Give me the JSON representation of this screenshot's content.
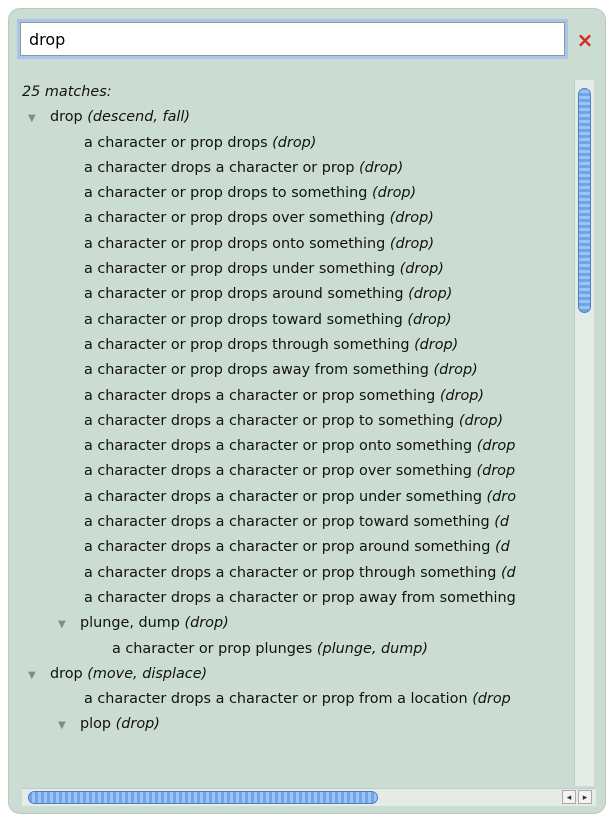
{
  "search": {
    "value": "drop",
    "clear_icon": "×"
  },
  "results": {
    "count_label": "25 matches:",
    "rows": [
      {
        "level": 0,
        "tri": true,
        "text": "drop ",
        "italic": "(descend, fall)"
      },
      {
        "level": 2,
        "tri": false,
        "text": "a character or prop drops ",
        "italic": "(drop)"
      },
      {
        "level": 2,
        "tri": false,
        "text": "a character drops a character or prop ",
        "italic": "(drop)"
      },
      {
        "level": 2,
        "tri": false,
        "text": "a character or prop drops to something ",
        "italic": "(drop)"
      },
      {
        "level": 2,
        "tri": false,
        "text": "a character or prop drops over something ",
        "italic": "(drop)"
      },
      {
        "level": 2,
        "tri": false,
        "text": "a character or prop drops onto something ",
        "italic": "(drop)"
      },
      {
        "level": 2,
        "tri": false,
        "text": "a character or prop drops under something ",
        "italic": "(drop)"
      },
      {
        "level": 2,
        "tri": false,
        "text": "a character or prop drops around something ",
        "italic": "(drop)"
      },
      {
        "level": 2,
        "tri": false,
        "text": "a character or prop drops toward something ",
        "italic": "(drop)"
      },
      {
        "level": 2,
        "tri": false,
        "text": "a character or prop drops through something ",
        "italic": "(drop)"
      },
      {
        "level": 2,
        "tri": false,
        "text": "a character or prop drops away from something ",
        "italic": "(drop)"
      },
      {
        "level": 2,
        "tri": false,
        "text": "a character drops a character or prop something ",
        "italic": "(drop)"
      },
      {
        "level": 2,
        "tri": false,
        "text": "a character drops a character or prop to something ",
        "italic": "(drop)"
      },
      {
        "level": 2,
        "tri": false,
        "text": "a character drops a character or prop onto something ",
        "italic": "(drop"
      },
      {
        "level": 2,
        "tri": false,
        "text": "a character drops a character or prop over something ",
        "italic": "(drop"
      },
      {
        "level": 2,
        "tri": false,
        "text": "a character drops a character or prop under something ",
        "italic": "(dro"
      },
      {
        "level": 2,
        "tri": false,
        "text": "a character drops a character or prop toward something ",
        "italic": "(d"
      },
      {
        "level": 2,
        "tri": false,
        "text": "a character drops a character or prop around something ",
        "italic": "(d"
      },
      {
        "level": 2,
        "tri": false,
        "text": "a character drops a character or prop through something ",
        "italic": "(d"
      },
      {
        "level": 2,
        "tri": false,
        "text": "a character drops a character or prop away from something",
        "italic": ""
      },
      {
        "level": 1,
        "tri": true,
        "text": "plunge, dump ",
        "italic": "(drop)"
      },
      {
        "level": 3,
        "tri": false,
        "text": "a character or prop plunges ",
        "italic": "(plunge, dump)"
      },
      {
        "level": 0,
        "tri": true,
        "text": "drop ",
        "italic": "(move, displace)"
      },
      {
        "level": 2,
        "tri": false,
        "text": "a character drops a character or prop from a location ",
        "italic": "(drop"
      },
      {
        "level": 1,
        "tri": true,
        "text": "plop ",
        "italic": "(drop)"
      }
    ]
  },
  "scroll": {
    "vertical_position": 0.0,
    "horizontal_position": 0.0,
    "left_arrow": "◂",
    "right_arrow": "▸"
  }
}
